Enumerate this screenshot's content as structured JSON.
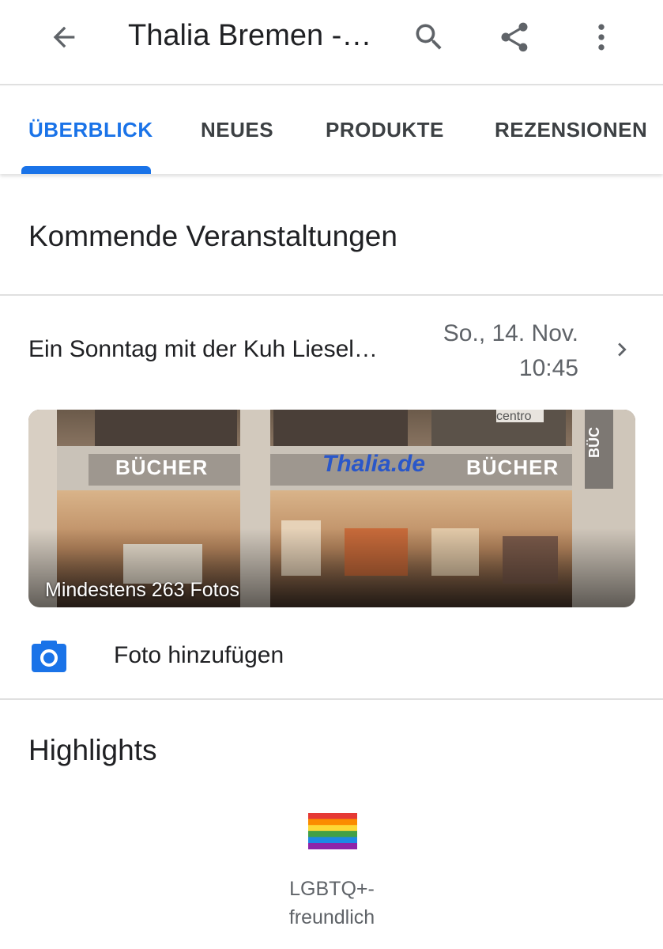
{
  "app_bar": {
    "title": "Thalia Bremen -…",
    "back_icon": "arrow-back-icon",
    "search_icon": "search-icon",
    "share_icon": "share-icon",
    "more_icon": "more-vert-icon"
  },
  "tabs": [
    {
      "label": "ÜBERBLICK",
      "active": true
    },
    {
      "label": "NEUES",
      "active": false
    },
    {
      "label": "PRODUKTE",
      "active": false
    },
    {
      "label": "REZENSIONEN",
      "active": false
    }
  ],
  "events": {
    "heading": "Kommende Veranstaltungen",
    "items": [
      {
        "name": "Ein Sonntag mit der Kuh Liesel…",
        "date": "So., 14. Nov.",
        "time": "10:45"
      }
    ]
  },
  "photos": {
    "count_label": "Mindestens 263 Fotos",
    "storefront_signs": [
      "BÜCHER",
      "Thalia.de",
      "BÜCHER",
      "BÜC",
      "centro"
    ]
  },
  "add_photo": {
    "label": "Foto hinzufügen",
    "icon": "camera-icon"
  },
  "highlights": {
    "heading": "Highlights",
    "items": [
      {
        "label": "LGBTQ+- freundlich",
        "label_line1": "LGBTQ+-",
        "label_line2": "freundlich",
        "icon": "rainbow-flag-icon"
      }
    ]
  },
  "colors": {
    "accent": "#1a73e8",
    "text_primary": "#202124",
    "text_secondary": "#5f6368",
    "divider": "#e0e0e0"
  }
}
